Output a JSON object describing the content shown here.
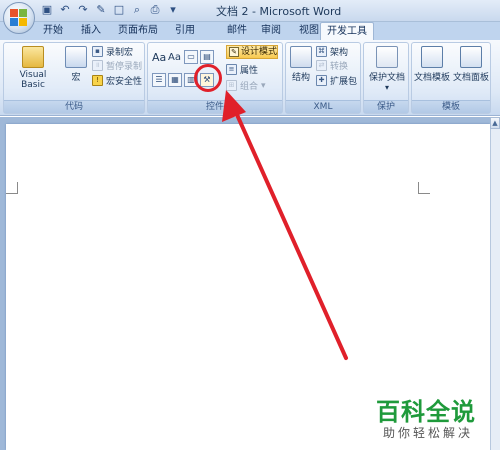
{
  "window": {
    "title": "文档 2 - Microsoft Word"
  },
  "quick_access": [
    "save-icon",
    "undo-icon",
    "redo-icon",
    "format-painter-icon",
    "new-doc-icon",
    "print-preview-icon",
    "print-icon",
    "customize-icon"
  ],
  "tabs": [
    {
      "label": "开始",
      "active": false
    },
    {
      "label": "插入",
      "active": false
    },
    {
      "label": "页面布局",
      "active": false
    },
    {
      "label": "引用",
      "active": false
    },
    {
      "label": "邮件",
      "active": false
    },
    {
      "label": "审阅",
      "active": false
    },
    {
      "label": "视图",
      "active": false
    },
    {
      "label": "开发工具",
      "active": true
    }
  ],
  "ribbon": {
    "code": {
      "label": "代码",
      "visual_basic": "Visual Basic",
      "macros": "宏",
      "record_macro": "录制宏",
      "pause_recording": "暂停录制",
      "macro_security": "宏安全性"
    },
    "controls": {
      "label": "控件",
      "text_aa_big": "Aa",
      "text_aa_small": "Aa",
      "design_mode": "设计模式",
      "properties": "属性",
      "group": "组合"
    },
    "xml": {
      "label": "XML",
      "structure": "结构",
      "schema": "架构",
      "transform": "转换",
      "expansion_packs": "扩展包"
    },
    "protect": {
      "label": "保护",
      "protect_document": "保护文档"
    },
    "templates": {
      "label": "模板",
      "document_template": "文档模板",
      "document_panel": "文档面板"
    }
  },
  "watermark": {
    "title": "百科全说",
    "subtitle": "助你轻松解决"
  },
  "colors": {
    "highlight": "#e0202a",
    "watermark_green": "#1f9a3b",
    "design_mode_bg": "#f8c94f"
  }
}
